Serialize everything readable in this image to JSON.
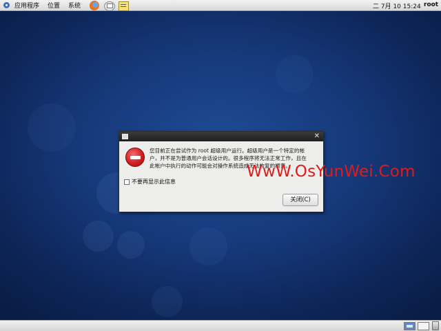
{
  "top_panel": {
    "menus": [
      "应用程序",
      "位置",
      "系统"
    ],
    "launchers": [
      "firefox-icon",
      "mail-icon",
      "notes-icon"
    ],
    "clock": "二 7月 10 15:24",
    "user": "root"
  },
  "dialog": {
    "title": "",
    "icon": "error-icon",
    "message_lines": [
      "您目前正在尝试作为 root 超级用户运行。超级用户是一个特定的帐",
      "户，并不是为普通用户会话设计的。很多程序将无法正常工作，且在",
      "此帐户中执行的动作可能会对操作系统造成无法恢复的损害。"
    ],
    "checkbox_label": "不要再显示此信息",
    "checkbox_checked": false,
    "close_button_label": "关闭(C)"
  },
  "watermark": "WwW.OsYunWei.Com",
  "colors": {
    "desktop": "#1f4c96",
    "watermark": "#e01b1b",
    "error_icon": "#d21f1f"
  }
}
